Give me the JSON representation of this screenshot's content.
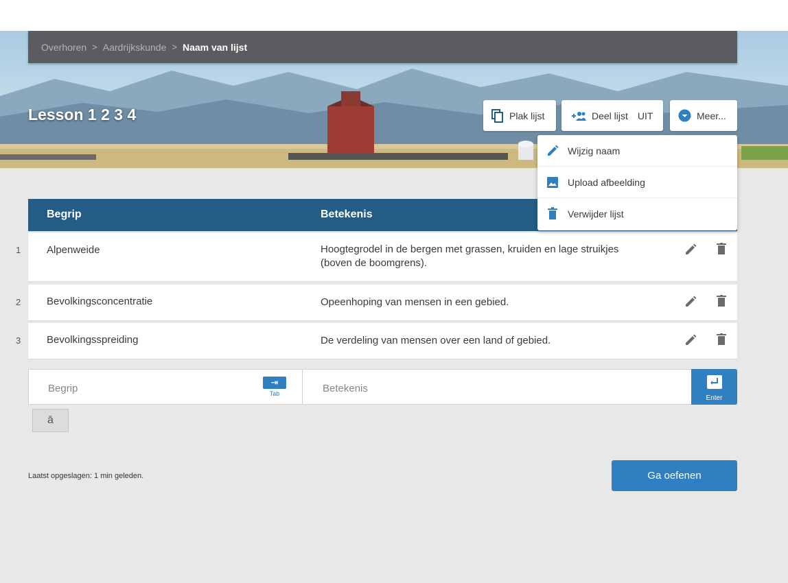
{
  "breadcrumb": {
    "items": [
      "Overhoren",
      "Aardrijkskunde"
    ],
    "current": "Naam van lijst",
    "separator": ">"
  },
  "lesson": {
    "title": "Lesson 1 2 3 4"
  },
  "header_buttons": {
    "plak": {
      "label": "Plak lijst",
      "icon": "copy-icon"
    },
    "deel": {
      "label": "Deel lijst",
      "status": "UIT",
      "icon": "add-people-icon"
    },
    "meer": {
      "label": "Meer...",
      "icon": "chevron-down-circle-icon"
    }
  },
  "menu": {
    "items": [
      {
        "label": "Wijzig naam",
        "icon": "pencil-icon"
      },
      {
        "label": "Upload afbeelding",
        "icon": "image-icon"
      },
      {
        "label": "Verwijder lijst",
        "icon": "trash-icon"
      }
    ]
  },
  "table": {
    "headers": {
      "term": "Begrip",
      "definition": "Betekenis"
    },
    "rows": [
      {
        "num": "1",
        "term": "Alpenweide",
        "definition": "Hoogtegrodel in de bergen met grassen, kruiden en lage struikjes (boven de boomgrens)."
      },
      {
        "num": "2",
        "term": "Bevolkingsconcentratie",
        "definition": "Opeenhoping van mensen in een gebied."
      },
      {
        "num": "3",
        "term": "Bevolkingsspreiding",
        "definition": "De verdeling van mensen over een land of gebied."
      }
    ]
  },
  "input_row": {
    "term_placeholder": "Begrip",
    "definition_placeholder": "Betekenis",
    "tab_label": "Tab",
    "enter_label": "Enter"
  },
  "special_char": "ā",
  "footer": {
    "saved_text": "Laatst opgeslagen: 1 min geleden.",
    "practice_label": "Ga oefenen"
  },
  "colors": {
    "accent": "#2f7fc1",
    "table_header": "#235d86",
    "breadcrumb_bar": "#5b5c5f",
    "background": "#e8e8e8"
  }
}
